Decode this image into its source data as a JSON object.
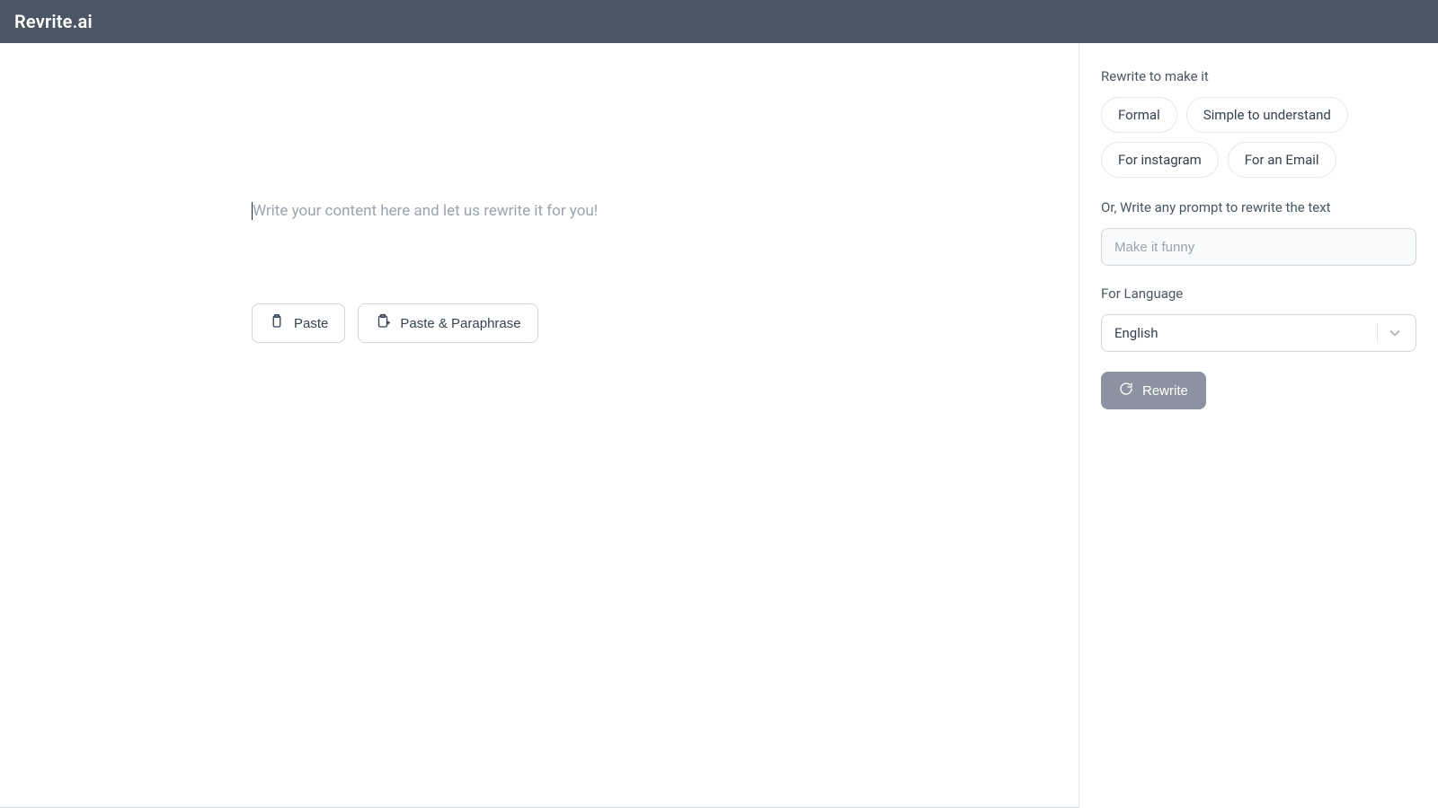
{
  "header": {
    "brand": "Revrite.ai"
  },
  "editor": {
    "placeholder": "Write your content here and let us rewrite it for you!",
    "value": "",
    "buttons": {
      "paste": "Paste",
      "paste_paraphrase": "Paste & Paraphrase"
    }
  },
  "sidebar": {
    "tone_label": "Rewrite to make it",
    "tones": [
      "Formal",
      "Simple to understand",
      "For instagram",
      "For an Email"
    ],
    "prompt_label": "Or, Write any prompt to rewrite the text",
    "prompt_placeholder": "Make it funny",
    "prompt_value": "",
    "language_label": "For Language",
    "language_selected": "English",
    "rewrite_button": "Rewrite"
  },
  "icons": {
    "clipboard": "clipboard-icon",
    "clipboard_plus": "clipboard-plus-icon",
    "refresh": "refresh-icon",
    "chevron_down": "chevron-down-icon"
  }
}
